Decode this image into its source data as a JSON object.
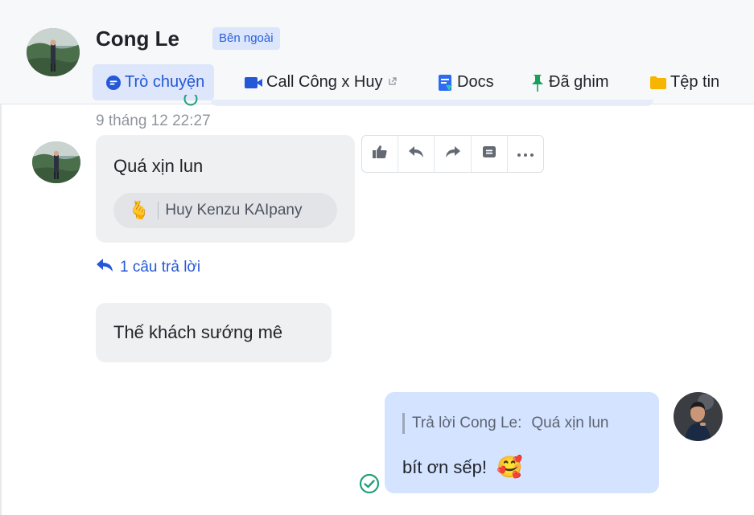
{
  "header": {
    "contact_name": "Cong Le",
    "external_badge": "Bên ngoài",
    "tabs": [
      {
        "label": "Trò chuyện",
        "icon": "chat-bubble-icon"
      },
      {
        "label": "Call Công x Huy",
        "icon": "video-camera-icon",
        "external": true
      },
      {
        "label": "Docs",
        "icon": "docs-icon"
      },
      {
        "label": "Đã ghim",
        "icon": "pin-icon"
      },
      {
        "label": "Tệp tin",
        "icon": "folder-icon"
      }
    ]
  },
  "messages": {
    "timestamp": "9 tháng 12 22:27",
    "first": {
      "text": "Quá xịn lun",
      "reaction": {
        "emoji": "🫰",
        "user": "Huy Kenzu KAIpany"
      }
    },
    "reply_count_label": "1 câu trả lời",
    "second": {
      "text": "Thế khách sướng mê"
    },
    "outgoing": {
      "quote_prefix": "Trả lời Cong Le:",
      "quote_text": "Quá xịn lun",
      "text": "bít ơn sếp!",
      "emoji": "🥰"
    }
  },
  "message_actions": [
    "thumbs-up-icon",
    "reply-icon",
    "forward-icon",
    "add-to-board-icon",
    "more-icon"
  ],
  "colors": {
    "accent": "#2458d6",
    "tab_active_bg": "#dde6fa",
    "bubble_in": "#eff0f1",
    "bubble_out": "#d4e3ff",
    "read_check": "#21a07a"
  }
}
